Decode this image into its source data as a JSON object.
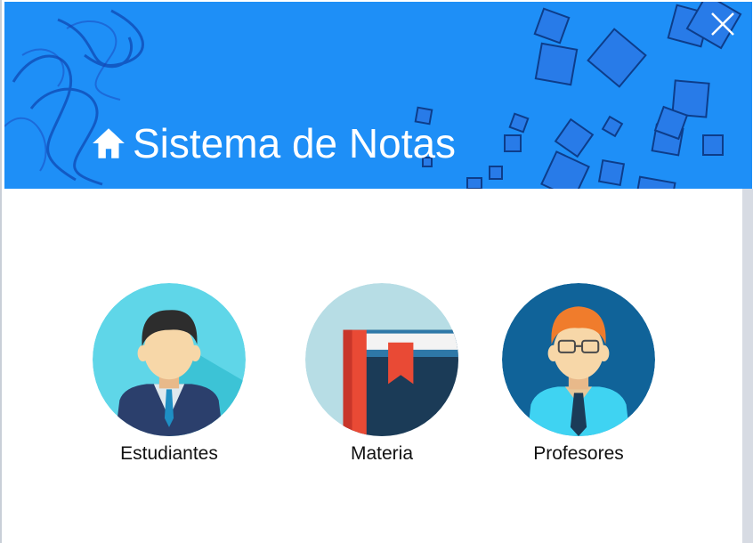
{
  "app": {
    "title": "Sistema de Notas"
  },
  "header": {
    "accent_color": "#1e8ff7",
    "icons": [
      "home-icon",
      "close-icon"
    ]
  },
  "menu": {
    "items": [
      {
        "label": "Estudiantes",
        "icon": "student-avatar-icon"
      },
      {
        "label": "Materia",
        "icon": "book-icon"
      },
      {
        "label": "Profesores",
        "icon": "teacher-avatar-icon"
      }
    ]
  }
}
